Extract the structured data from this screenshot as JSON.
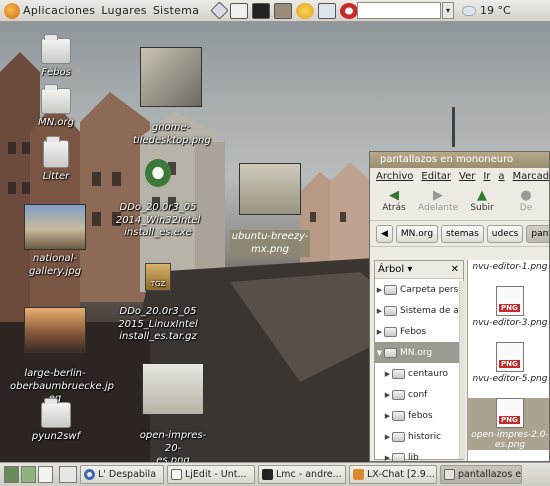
{
  "top_panel": {
    "menus": [
      "Aplicaciones",
      "Lugares",
      "Sistema"
    ],
    "launchers": [
      "network-icon",
      "mail-icon",
      "terminal-icon",
      "gimp-icon",
      "settings-icon",
      "screenshot-icon",
      "firefox-icon"
    ],
    "search_value": "",
    "weather": "19 °C"
  },
  "desktop_icons": [
    {
      "label": "Febos"
    },
    {
      "label": "MN.org"
    },
    {
      "label": "Litter"
    },
    {
      "label": "gnome-\ntiledesktop.png"
    },
    {
      "label": "DDo_20.0r3_05\n2014_Win32Intel\ninstall_es.exe"
    },
    {
      "label": "national-gallery.jpg"
    },
    {
      "label": "ubuntu-breezy-\nmx.png"
    },
    {
      "label": "DDo_20.0r3_05\n2015_LinuxIntel\ninstall_es.tar.gz"
    },
    {
      "label": "large-berlin-\noberbaumbruecke.jp\neg"
    },
    {
      "label": "open-impres-20-\nes.png"
    },
    {
      "label": "pyun2swf"
    }
  ],
  "file_window": {
    "title": "pantallazos en mononeuro",
    "menu": [
      "Archivo",
      "Editar",
      "Ver",
      "Ir",
      "a",
      "Marcadores"
    ],
    "toolbar": [
      "Atrás",
      "Adelante",
      "Subir",
      "De"
    ],
    "breadcrumbs": [
      "MN.org",
      "stemas",
      "udecs",
      "pantallazos"
    ],
    "sidebar_header": "Árbol",
    "sidebar_items": [
      {
        "label": "Carpeta pers",
        "level": 0,
        "open": false
      },
      {
        "label": "Sistema de a",
        "level": 0,
        "open": false
      },
      {
        "label": "Febos",
        "level": 0,
        "open": false
      },
      {
        "label": "MN.org",
        "level": 0,
        "open": true
      },
      {
        "label": "centauro",
        "level": 1,
        "open": false
      },
      {
        "label": "conf",
        "level": 1,
        "open": false
      },
      {
        "label": "febos",
        "level": 1,
        "open": false
      },
      {
        "label": "historic",
        "level": 1,
        "open": false
      },
      {
        "label": "lib",
        "level": 1,
        "open": false
      }
    ],
    "files": [
      {
        "label": "nvu-editor-1.png"
      },
      {
        "label": "nvu-editor-3.png"
      },
      {
        "label": "nvu-editor-5.png"
      },
      {
        "label": "open-impres-2.0-\nes.png"
      }
    ]
  },
  "taskbar": [
    {
      "label": "L' Despabila"
    },
    {
      "label": "LjEdit - Unt..."
    },
    {
      "label": "Lmc - andre..."
    },
    {
      "label": "LX-Chat [2.9..."
    },
    {
      "label": "pantallazos e..."
    }
  ]
}
